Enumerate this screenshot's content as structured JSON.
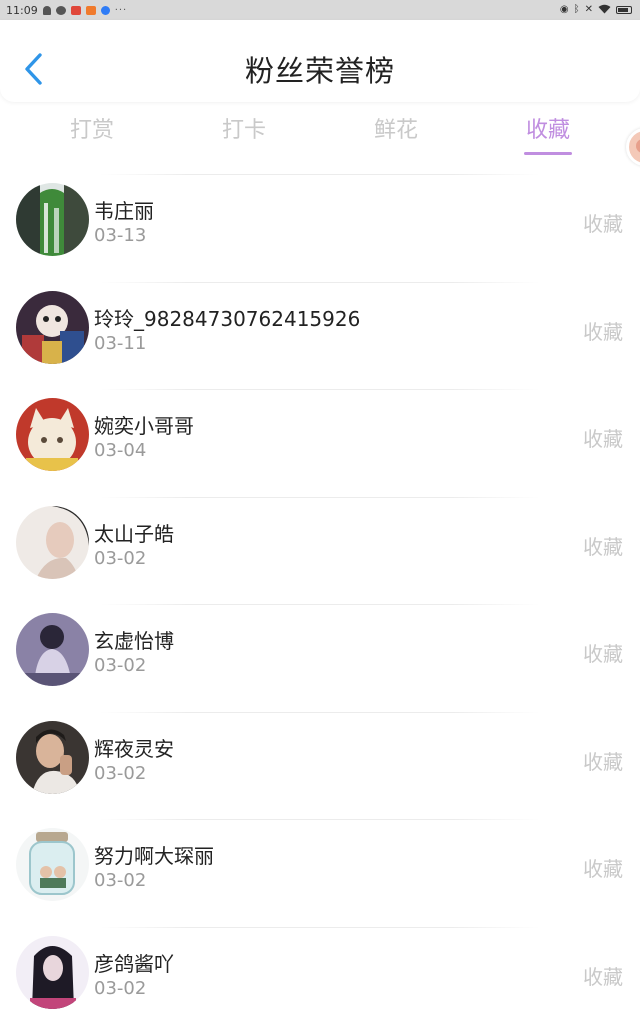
{
  "status_bar": {
    "time": "11:09",
    "more": "···",
    "left_icons": [
      "bell-icon",
      "chat-icon",
      "app-red-icon",
      "app-orange-icon",
      "app-blue-icon"
    ],
    "right_icons": [
      "eye-icon",
      "bluetooth-icon",
      "mute-icon",
      "wifi-icon",
      "battery-icon"
    ]
  },
  "header": {
    "title": "粉丝荣誉榜",
    "back_icon": "chevron-left-icon",
    "accent": "#2f95e8"
  },
  "tabs": [
    {
      "label": "打赏",
      "active": false
    },
    {
      "label": "打卡",
      "active": false
    },
    {
      "label": "鲜花",
      "active": false
    },
    {
      "label": "收藏",
      "active": true
    }
  ],
  "colors": {
    "active_tab": "#c08ee0",
    "inactive_tab": "#c9c9c9"
  },
  "fans": [
    {
      "name": "韦庄丽",
      "date": "03-13",
      "action": "收藏"
    },
    {
      "name": "玲玲_98284730762415926",
      "date": "03-11",
      "action": "收藏"
    },
    {
      "name": "婉奕小哥哥",
      "date": "03-04",
      "action": "收藏"
    },
    {
      "name": "太山子皓",
      "date": "03-02",
      "action": "收藏"
    },
    {
      "name": "玄虚怡博",
      "date": "03-02",
      "action": "收藏"
    },
    {
      "name": "辉夜灵安",
      "date": "03-02",
      "action": "收藏"
    },
    {
      "name": "努力啊大琛丽",
      "date": "03-02",
      "action": "收藏"
    },
    {
      "name": "彦鸽酱吖",
      "date": "03-02",
      "action": "收藏"
    }
  ]
}
